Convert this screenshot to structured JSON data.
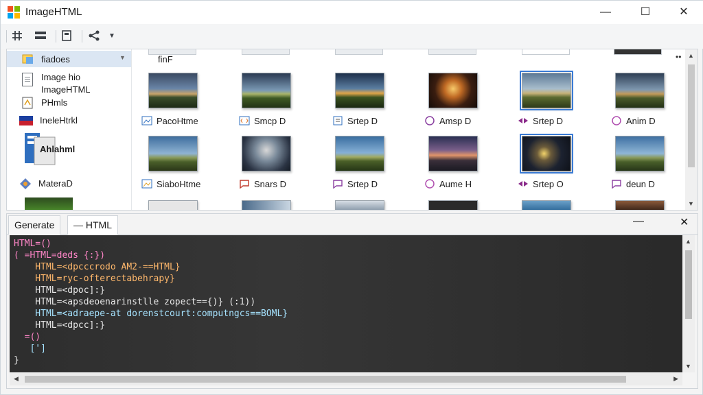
{
  "app": {
    "title": "ImageHTML"
  },
  "window_controls": {
    "minimize": "—",
    "maximize": "☐",
    "close": "✕"
  },
  "toolbar": {
    "icons": [
      "grid-icon",
      "list-icon",
      "page-icon",
      "share-icon",
      "dropdown-icon"
    ]
  },
  "tree": {
    "items": [
      {
        "label": "fiadoes",
        "selected": true
      },
      {
        "label": "Image hio"
      },
      {
        "label": "ImageHTML"
      },
      {
        "label": "PHmls"
      },
      {
        "label": "IneleHtrkl"
      },
      {
        "label": "Ahlahml"
      },
      {
        "label": "MateraD"
      }
    ]
  },
  "grid": {
    "top_partial_caption": "finF",
    "row1": [
      {
        "caption": "PacoHtme",
        "icon": "image-icon"
      },
      {
        "caption": "Smcp D",
        "icon": "code-icon"
      },
      {
        "caption": "Srtep D",
        "icon": "file-icon"
      },
      {
        "caption": "Amsp D",
        "icon": "heart-icon"
      },
      {
        "caption": "Srtep D",
        "icon": "bow-icon",
        "selected": true
      },
      {
        "caption": "Anim D",
        "icon": "heart-icon"
      }
    ],
    "row2": [
      {
        "caption": "SiaboHtme",
        "icon": "image-icon"
      },
      {
        "caption": "Snars D",
        "icon": "chat-icon"
      },
      {
        "caption": "Srtep D",
        "icon": "chat-icon"
      },
      {
        "caption": "Aume H",
        "icon": "heart-icon"
      },
      {
        "caption": "Srtep O",
        "icon": "bow-icon",
        "selected": true
      },
      {
        "caption": "deun D",
        "icon": "chat-icon"
      }
    ]
  },
  "panel": {
    "tabs": [
      "Generate",
      "— HTML"
    ],
    "minimize": "—",
    "close": "✕",
    "code_lines": [
      "HTML=()",
      "( =HTML=deds {:})",
      "    HTML=<dpcccrodo AM2-==HTML}",
      "    HTML=ryc-ofterectabehrapy}",
      "    HTML=<dpoc]:}",
      "    HTML=<apsdeoenarinstlle zopect=={)} (:1))",
      "    HTML=<adraepe-at dorenstcourt:computngcs==BOML}",
      "    HTML=<dpcc]:}",
      "  =()",
      "   [']",
      "}"
    ]
  },
  "colors": {
    "selection": "#dbe6f3",
    "accent": "#3a7bd5",
    "code_bg": "#2a2a2a"
  }
}
